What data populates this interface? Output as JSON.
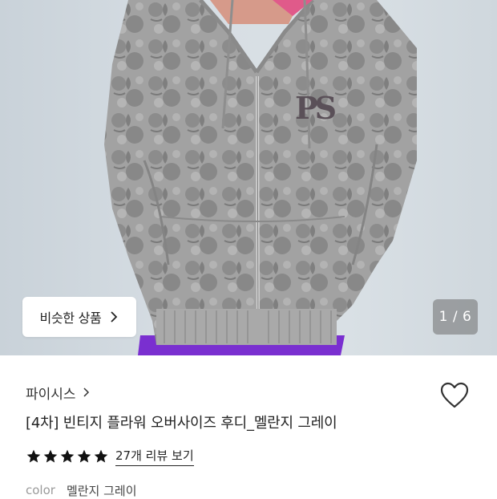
{
  "product_image": {
    "similar_button_label": "비슷한 상품",
    "image_counter": "1 / 6",
    "logo_text": "PS"
  },
  "product": {
    "brand": "파이시스",
    "title": "[4차] 빈티지 플라워 오버사이즈 후디_멜란지 그레이",
    "rating_stars": 5,
    "review_link": "27개 리뷰 보기",
    "color_label": "color",
    "color_value": "멜란지 그레이"
  },
  "colors": {
    "star": "#111111",
    "hoodie": "#9b9b9b",
    "pants": "#7a2fd0"
  }
}
